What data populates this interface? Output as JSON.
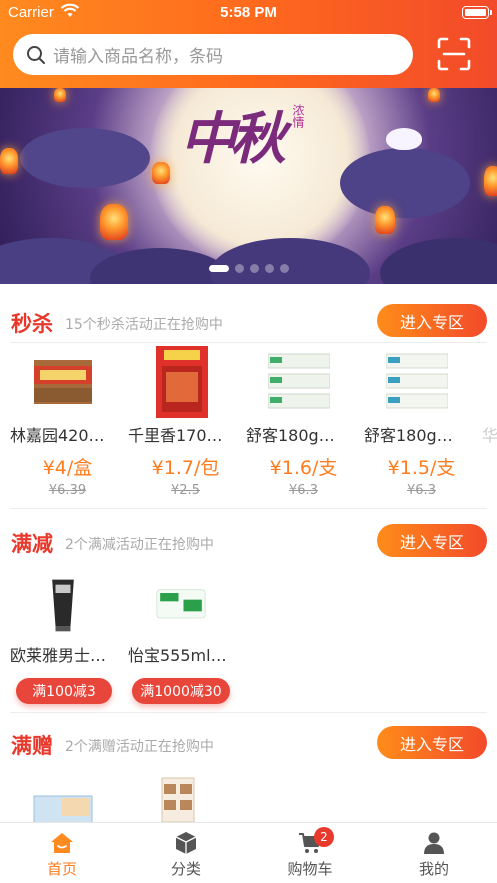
{
  "status_bar": {
    "carrier": "Carrier",
    "time": "5:58 PM"
  },
  "search": {
    "placeholder": "请输入商品名称，条码"
  },
  "banner": {
    "title": "中秋",
    "subtitle": "浓情",
    "slides": 5,
    "active_slide": 1
  },
  "sections": [
    {
      "title": "秒杀",
      "subtitle": "15个秒杀活动正在抢购中",
      "button": "进入专区",
      "products": [
        {
          "name": "林嘉园420…",
          "price": "¥4/盒",
          "original": "¥6.39"
        },
        {
          "name": "千里香170…",
          "price": "¥1.7/包",
          "original": "¥2.5"
        },
        {
          "name": "舒客180g…",
          "price": "¥1.6/支",
          "original": "¥6.3"
        },
        {
          "name": "舒客180g…",
          "price": "¥1.5/支",
          "original": "¥6.3"
        },
        {
          "name": "华",
          "price": "",
          "original": ""
        }
      ]
    },
    {
      "title": "满减",
      "subtitle": "2个满减活动正在抢购中",
      "button": "进入专区",
      "products": [
        {
          "name": "欧莱雅男士…",
          "tag": "满100减3"
        },
        {
          "name": "怡宝555ml…",
          "tag": "满1000减30"
        }
      ]
    },
    {
      "title": "满赠",
      "subtitle": "2个满赠活动正在抢购中",
      "button": "进入专区",
      "products": []
    }
  ],
  "tabbar": {
    "items": [
      {
        "label": "首页",
        "icon": "home-icon",
        "active": true
      },
      {
        "label": "分类",
        "icon": "box-icon",
        "active": false
      },
      {
        "label": "购物车",
        "icon": "cart-icon",
        "active": false,
        "badge": "2"
      },
      {
        "label": "我的",
        "icon": "user-icon",
        "active": false
      }
    ]
  },
  "colors": {
    "accent": "#ff7d20",
    "red": "#e8382c",
    "gradient_start": "#ff8a1f",
    "gradient_end": "#f24a2a"
  }
}
